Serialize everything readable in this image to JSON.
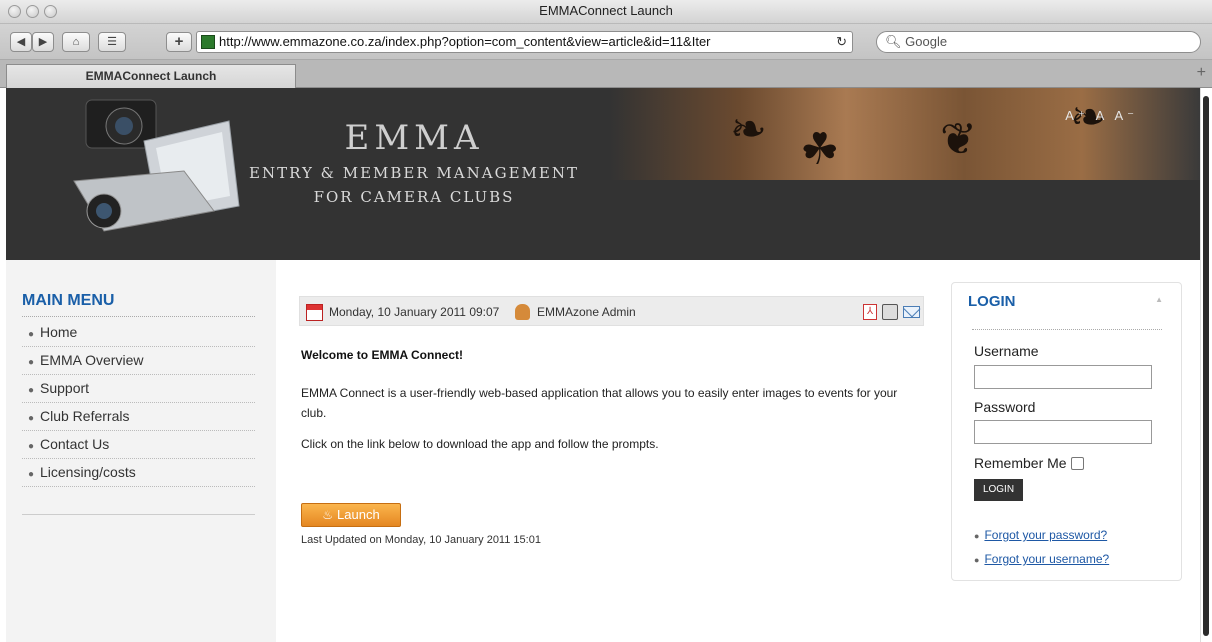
{
  "window": {
    "title": "EMMAConnect Launch"
  },
  "toolbar": {
    "url": "http://www.emmazone.co.za/index.php?option=com_content&view=article&id=11&Iter",
    "search_placeholder": "Google"
  },
  "tabs": [
    {
      "label": "EMMAConnect Launch"
    }
  ],
  "banner": {
    "brand": "EMMA",
    "subtitle_line1": "ENTRY & MEMBER MANAGEMENT",
    "subtitle_line2": "FOR CAMERA CLUBS",
    "font_controls": "A⁺ A A⁻"
  },
  "menu": {
    "title": "MAIN MENU",
    "items": [
      {
        "label": "Home"
      },
      {
        "label": "EMMA Overview"
      },
      {
        "label": "Support"
      },
      {
        "label": "Club Referrals"
      },
      {
        "label": "Contact Us"
      },
      {
        "label": "Licensing/costs"
      }
    ]
  },
  "article": {
    "date": "Monday, 10 January 2011 09:07",
    "author": "EMMAzone Admin",
    "heading": "Welcome to EMMA Connect!",
    "paragraph1": "EMMA Connect is a user-friendly web-based application that allows you to easily enter images to events for your club.",
    "paragraph2": "Click on the link below to download the app and follow the prompts.",
    "launch_label": "Launch",
    "last_updated": "Last Updated on Monday, 10 January 2011 15:01"
  },
  "login": {
    "title": "LOGIN",
    "username_label": "Username",
    "password_label": "Password",
    "remember_label": "Remember Me",
    "button_label": "LOGIN",
    "forgot_password": "Forgot your password?",
    "forgot_username": "Forgot your username?"
  },
  "colors": {
    "accent_blue": "#1a5fa8",
    "banner_bg": "#333333",
    "launch_orange": "#e48722"
  }
}
